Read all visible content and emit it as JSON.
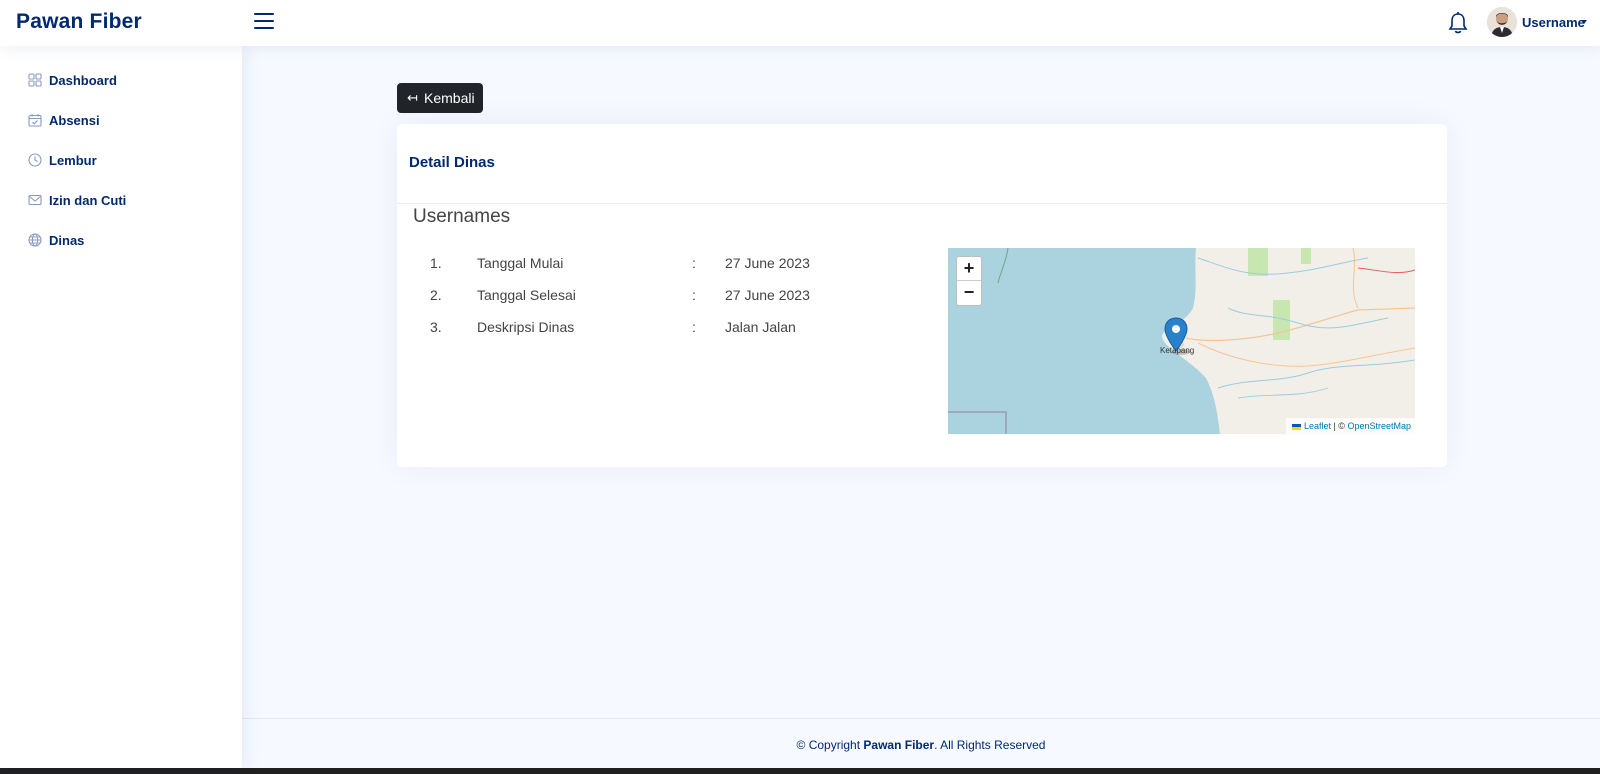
{
  "header": {
    "brand": "Pawan Fiber",
    "user_name": "Username",
    "icons": [
      "menu-icon",
      "bell-icon",
      "avatar",
      "caret-down-icon"
    ]
  },
  "sidebar": {
    "items": [
      {
        "label": "Dashboard",
        "icon": "grid-icon"
      },
      {
        "label": "Absensi",
        "icon": "calendar-check-icon"
      },
      {
        "label": "Lembur",
        "icon": "clock-icon"
      },
      {
        "label": "Izin dan Cuti",
        "icon": "envelope-icon"
      },
      {
        "label": "Dinas",
        "icon": "globe-icon"
      }
    ]
  },
  "main": {
    "back_button": {
      "arrow": "↤",
      "label": "Kembali"
    },
    "card": {
      "title": "Detail Dinas",
      "user_heading": "Usernames",
      "details": [
        {
          "no": "1.",
          "key": "Tanggal Mulai",
          "sep": ":",
          "value": "27 June 2023"
        },
        {
          "no": "2.",
          "key": "Tanggal Selesai",
          "sep": ":",
          "value": "27 June 2023"
        },
        {
          "no": "3.",
          "key": "Deskripsi Dinas",
          "sep": ":",
          "value": "Jalan Jalan"
        }
      ],
      "map": {
        "zoom_in": "+",
        "zoom_out": "−",
        "place_label": "Ketapang",
        "attribution_leaflet": "Leaflet",
        "attribution_sep": " | © ",
        "attribution_osm": "OpenStreetMap",
        "colors": {
          "water": "#aad3df",
          "land": "#f2efe9",
          "forest": "#c8e6b0",
          "marker": "#2a81cb"
        }
      }
    }
  },
  "footer": {
    "prefix": "© Copyright ",
    "brand": "Pawan Fiber",
    "suffix": ". All Rights Reserved"
  },
  "colors": {
    "primary": "#012970",
    "background": "#f6f9ff",
    "button_dark": "#212529"
  }
}
